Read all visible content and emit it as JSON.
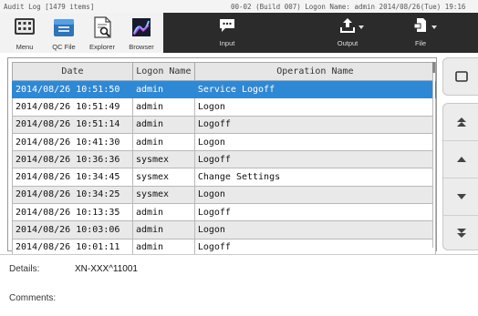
{
  "titlebar": {
    "left": "Audit Log [1479 items]",
    "right": "00-02 (Build 007)  Logon Name: admin  2014/08/26(Tue) 19:16"
  },
  "toolbar": {
    "menu": {
      "label": "Menu",
      "icon": "keypad-icon"
    },
    "qc_file": {
      "label": "QC File",
      "icon": "qc-file-icon"
    },
    "explorer": {
      "label": "Explorer",
      "icon": "explorer-icon"
    },
    "browser": {
      "label": "Browser",
      "icon": "browser-icon"
    },
    "input": {
      "label": "Input",
      "icon": "speech-bubble-icon"
    },
    "output": {
      "label": "Output",
      "icon": "upload-tray-icon"
    },
    "file": {
      "label": "File",
      "icon": "document-icon"
    }
  },
  "table": {
    "columns": [
      "Date",
      "Logon Name",
      "Operation Name"
    ],
    "rows": [
      [
        "2014/08/26 10:51:50",
        "admin",
        "Service Logoff"
      ],
      [
        "2014/08/26 10:51:49",
        "admin",
        "Logon"
      ],
      [
        "2014/08/26 10:51:14",
        "admin",
        "Logoff"
      ],
      [
        "2014/08/26 10:41:30",
        "admin",
        "Logon"
      ],
      [
        "2014/08/26 10:36:36",
        "sysmex",
        "Logoff"
      ],
      [
        "2014/08/26 10:34:45",
        "sysmex",
        "Change Settings"
      ],
      [
        "2014/08/26 10:34:25",
        "sysmex",
        "Logon"
      ],
      [
        "2014/08/26 10:13:35",
        "admin",
        "Logoff"
      ],
      [
        "2014/08/26 10:03:06",
        "admin",
        "Logon"
      ],
      [
        "2014/08/26 10:01:11",
        "admin",
        "Logoff"
      ]
    ],
    "selected_row": 0
  },
  "details": {
    "details_label": "Details:",
    "details_value": "XN-XXX^11001",
    "comments_label": "Comments:"
  },
  "colors": {
    "selection": "#2f88d4",
    "toolbar_dark": "#2b2b2b"
  }
}
